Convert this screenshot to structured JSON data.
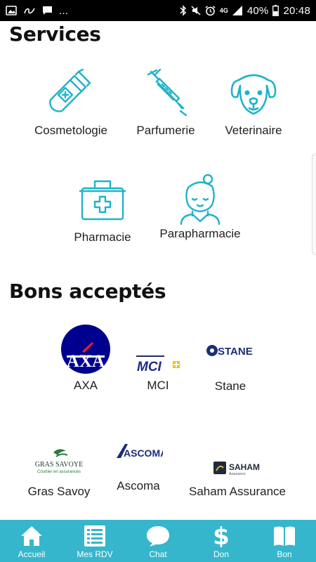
{
  "status_bar": {
    "overflow": "...",
    "network": "4G",
    "battery": "40%",
    "time": "20:48"
  },
  "services": {
    "title": "Services",
    "items": [
      {
        "label": "Cosmetologie",
        "icon": "lotion-bottle-icon"
      },
      {
        "label": "Parfumerie",
        "icon": "syringe-icon"
      },
      {
        "label": "Veterinaire",
        "icon": "dog-icon"
      },
      {
        "label": "Pharmacie",
        "icon": "first-aid-kit-icon"
      },
      {
        "label": "Parapharmacie",
        "icon": "nurse-icon"
      }
    ]
  },
  "bons": {
    "title": "Bons acceptés",
    "items": [
      {
        "label": "AXA",
        "logo_text": "AXA"
      },
      {
        "label": "MCI",
        "logo_text": "MCI"
      },
      {
        "label": "Stane",
        "logo_text": "STANE"
      },
      {
        "label": "Gras Savoy",
        "logo_text": "GRAS SAVOYE",
        "logo_subtext": "Courtier en assurances"
      },
      {
        "label": "Ascoma",
        "logo_text": "ASCOMA"
      },
      {
        "label": "Saham Assurance",
        "logo_text": "SAHAM",
        "logo_subtext": "Assurance"
      }
    ]
  },
  "colors": {
    "accent": "#1fb3c8",
    "tabbar": "#35b6cc",
    "axa_blue": "#00008f",
    "axa_red": "#ff1721"
  },
  "tabs": [
    {
      "label": "Accueil",
      "icon": "home-icon"
    },
    {
      "label": "Mes RDV",
      "icon": "list-icon"
    },
    {
      "label": "Chat",
      "icon": "chat-bubble-icon"
    },
    {
      "label": "Don",
      "icon": "dollar-icon"
    },
    {
      "label": "Bon",
      "icon": "book-icon"
    }
  ]
}
